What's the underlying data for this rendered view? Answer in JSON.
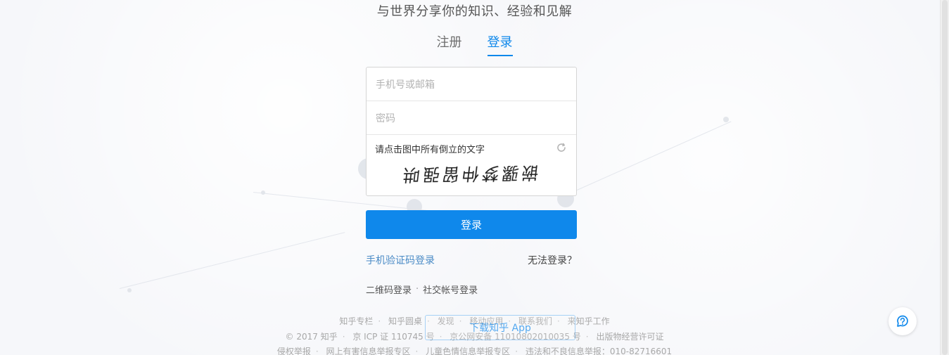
{
  "header": {
    "slogan": "与世界分享你的知识、经验和见解"
  },
  "tabs": [
    {
      "label": "注册",
      "active": false
    },
    {
      "label": "登录",
      "active": true
    }
  ],
  "form": {
    "account_placeholder": "手机号或邮箱",
    "password_placeholder": "密码",
    "captcha_prompt": "请点击图中所有倒立的文字",
    "captcha_chars": [
      "哄",
      "强",
      "留",
      "仲",
      "梦",
      "骡",
      "嵌"
    ],
    "refresh_icon": "refresh-icon"
  },
  "actions": {
    "submit_label": "登录",
    "sms_login_label": "手机验证码登录",
    "cannot_login_label": "无法登录？",
    "qr_login_label": "二维码登录",
    "social_login_label": "社交帐号登录",
    "alt_sep": "·"
  },
  "download": {
    "label": "下载知乎 App"
  },
  "footer": {
    "row1": [
      "知乎专栏",
      "知乎圆桌",
      "发现",
      "移动应用",
      "联系我们",
      "来知乎工作"
    ],
    "row2": [
      "© 2017 知乎",
      "京 ICP 证 110745 号",
      "京公网安备 11010802010035 号",
      "出版物经营许可证"
    ],
    "row3": [
      "侵权举报",
      "网上有害信息举报专区",
      "儿童色情信息举报专区",
      "违法和不良信息举报：010-82716601"
    ],
    "sep": "·"
  },
  "colors": {
    "brand_blue": "#0f88eb",
    "link_blue": "#4a8bc6",
    "background": "#f6f7fa"
  },
  "widgets": {
    "help_icon": "chat-help-icon"
  }
}
